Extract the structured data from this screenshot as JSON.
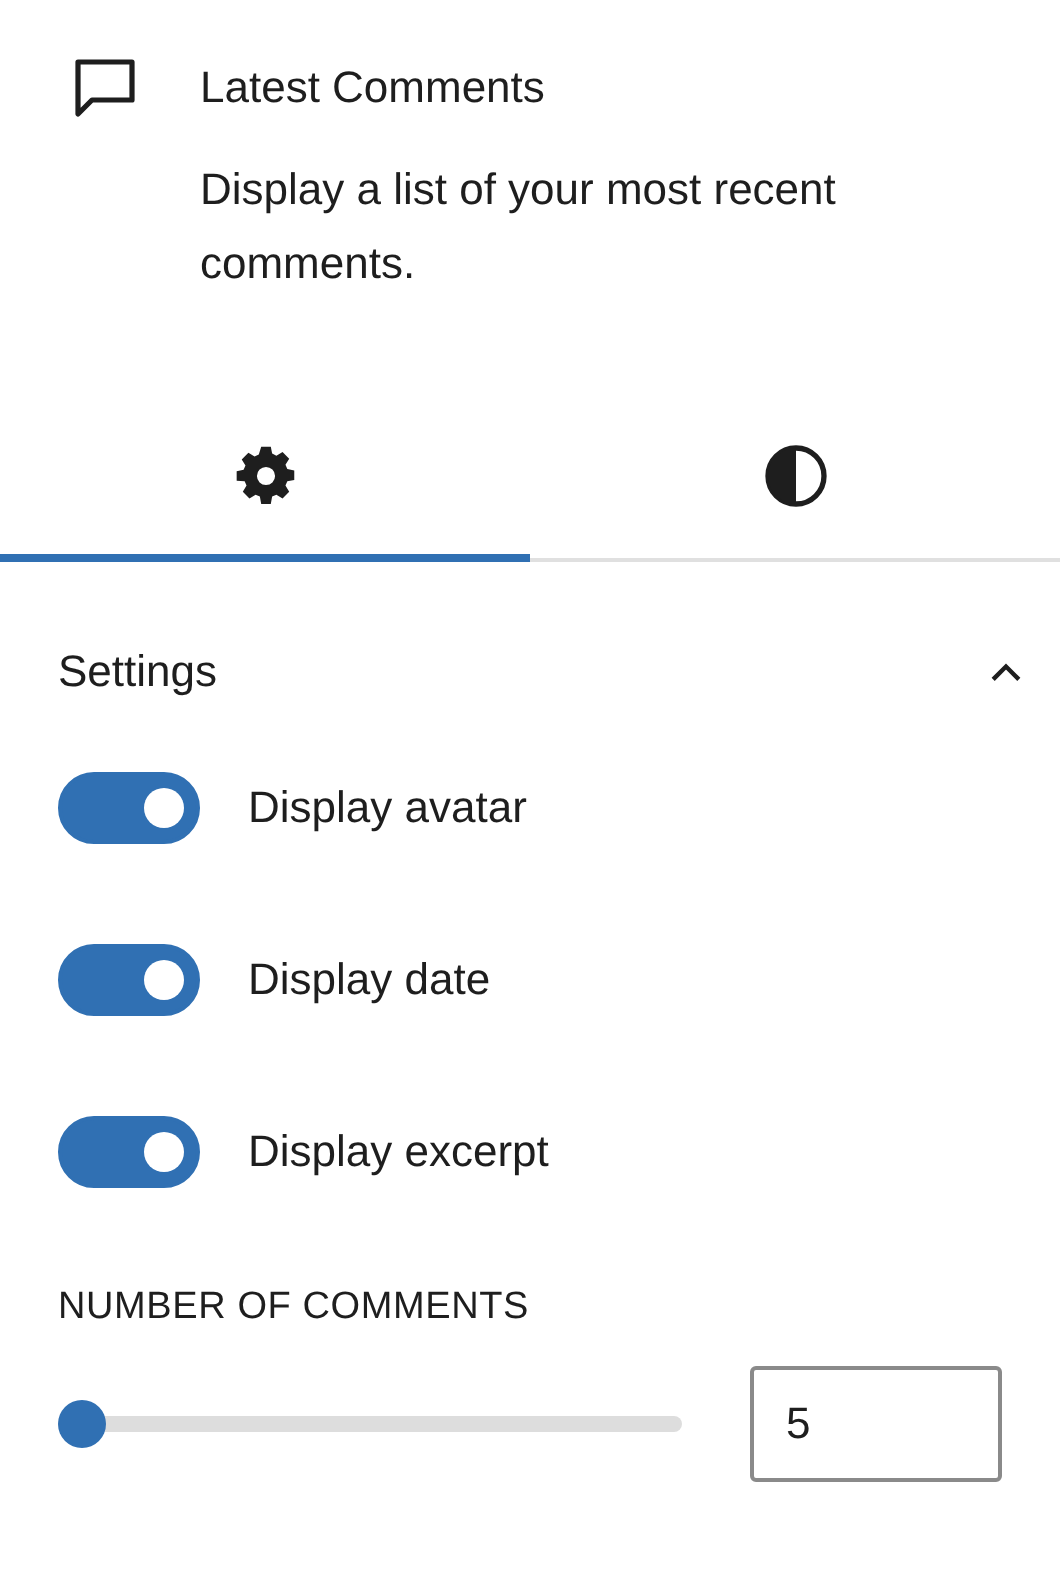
{
  "block": {
    "title": "Latest Comments",
    "description": "Display a list of your most recent comments."
  },
  "tabs": [
    {
      "kind": "gear",
      "selected": true
    },
    {
      "kind": "contrast",
      "selected": false
    }
  ],
  "panel": {
    "title": "Settings",
    "expanded": true,
    "toggles": [
      {
        "label": "Display avatar",
        "on": true
      },
      {
        "label": "Display date",
        "on": true
      },
      {
        "label": "Display excerpt",
        "on": true
      }
    ],
    "range": {
      "label": "NUMBER OF COMMENTS",
      "level": 0.04,
      "value": "5"
    }
  }
}
